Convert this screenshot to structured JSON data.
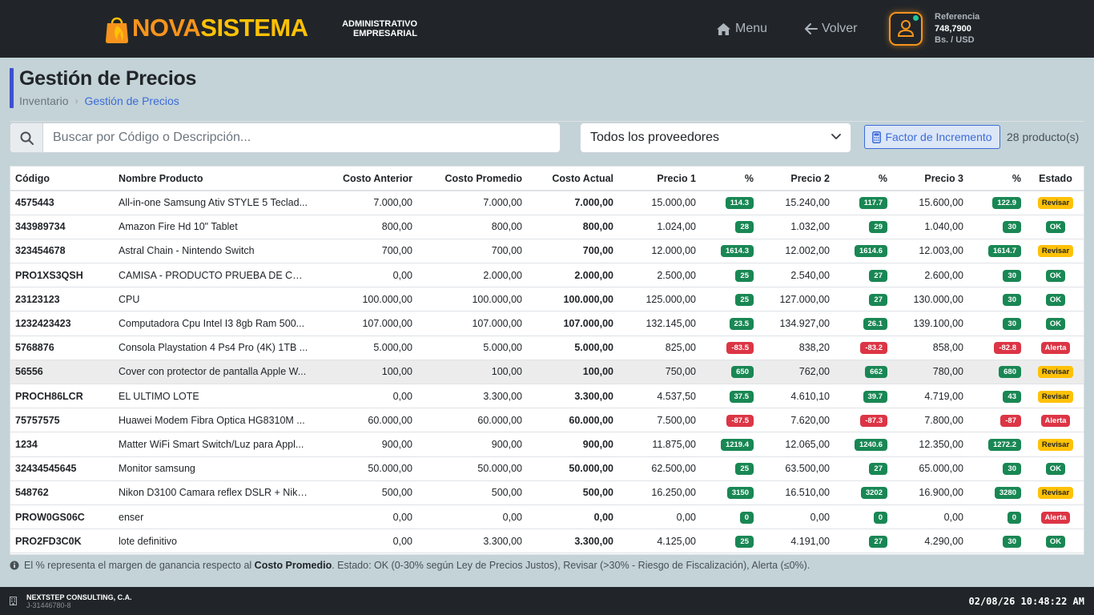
{
  "brand": {
    "name_part1": "NOVA",
    "name_part2": "SISTEMA",
    "subtitle_line1": "ADMINISTRATIVO",
    "subtitle_line2": "EMPRESARIAL",
    "colors": {
      "orange": "#f7941d",
      "yellow": "#ffc107"
    }
  },
  "nav": {
    "menu_label": "Menu",
    "back_label": "Volver"
  },
  "reference": {
    "label": "Referencia",
    "value": "748,7900",
    "unit": "Bs. / USD"
  },
  "page": {
    "title": "Gestión de Precios",
    "breadcrumb": [
      "Inventario",
      "Gestión de Precios"
    ]
  },
  "filters": {
    "search_placeholder": "Buscar por Código o Descripción...",
    "supplier_selected": "Todos los proveedores",
    "factor_button_label": "Factor de Incremento",
    "product_count": "28 producto(s)"
  },
  "table": {
    "headers": [
      "Código",
      "Nombre Producto",
      "Costo Anterior",
      "Costo Promedio",
      "Costo Actual",
      "Precio 1",
      "%",
      "Precio 2",
      "%",
      "Precio 3",
      "%",
      "Estado"
    ],
    "rows": [
      {
        "code": "4575443",
        "name": "All-in-one Samsung Ativ STYLE 5 Teclad...",
        "cost_prev": "7.000,00",
        "cost_avg": "7.000,00",
        "cost_cur": "7.000,00",
        "p1": "15.000,00",
        "pct1": "114.3",
        "p2": "15.240,00",
        "pct2": "117.7",
        "p3": "15.600,00",
        "pct3": "122.9",
        "status": "Revisar"
      },
      {
        "code": "343989734",
        "name": "Amazon Fire Hd 10\" Tablet",
        "cost_prev": "800,00",
        "cost_avg": "800,00",
        "cost_cur": "800,00",
        "p1": "1.024,00",
        "pct1": "28",
        "p2": "1.032,00",
        "pct2": "29",
        "p3": "1.040,00",
        "pct3": "30",
        "status": "OK"
      },
      {
        "code": "323454678",
        "name": "Astral Chain - Nintendo Switch",
        "cost_prev": "700,00",
        "cost_avg": "700,00",
        "cost_cur": "700,00",
        "p1": "12.000,00",
        "pct1": "1614.3",
        "p2": "12.002,00",
        "pct2": "1614.6",
        "p3": "12.003,00",
        "pct3": "1614.7",
        "status": "Revisar"
      },
      {
        "code": "PRO1XS3QSH",
        "name": "CAMISA - PRODUCTO PRUEBA DE COL...",
        "cost_prev": "0,00",
        "cost_avg": "2.000,00",
        "cost_cur": "2.000,00",
        "p1": "2.500,00",
        "pct1": "25",
        "p2": "2.540,00",
        "pct2": "27",
        "p3": "2.600,00",
        "pct3": "30",
        "status": "OK"
      },
      {
        "code": "23123123",
        "name": "CPU",
        "cost_prev": "100.000,00",
        "cost_avg": "100.000,00",
        "cost_cur": "100.000,00",
        "p1": "125.000,00",
        "pct1": "25",
        "p2": "127.000,00",
        "pct2": "27",
        "p3": "130.000,00",
        "pct3": "30",
        "status": "OK"
      },
      {
        "code": "1232423423",
        "name": "Computadora Cpu Intel I3 8gb Ram 500...",
        "cost_prev": "107.000,00",
        "cost_avg": "107.000,00",
        "cost_cur": "107.000,00",
        "p1": "132.145,00",
        "pct1": "23.5",
        "p2": "134.927,00",
        "pct2": "26.1",
        "p3": "139.100,00",
        "pct3": "30",
        "status": "OK"
      },
      {
        "code": "5768876",
        "name": "Consola Playstation 4 Ps4 Pro (4K) 1TB ...",
        "cost_prev": "5.000,00",
        "cost_avg": "5.000,00",
        "cost_cur": "5.000,00",
        "p1": "825,00",
        "pct1": "-83.5",
        "p2": "838,20",
        "pct2": "-83.2",
        "p3": "858,00",
        "pct3": "-82.8",
        "status": "Alerta"
      },
      {
        "code": "56556",
        "name": "Cover con protector de pantalla Apple W...",
        "cost_prev": "100,00",
        "cost_avg": "100,00",
        "cost_cur": "100,00",
        "p1": "750,00",
        "pct1": "650",
        "p2": "762,00",
        "pct2": "662",
        "p3": "780,00",
        "pct3": "680",
        "status": "Revisar",
        "highlight": true
      },
      {
        "code": "PROCH86LCR",
        "name": "EL ULTIMO LOTE",
        "cost_prev": "0,00",
        "cost_avg": "3.300,00",
        "cost_cur": "3.300,00",
        "p1": "4.537,50",
        "pct1": "37.5",
        "p2": "4.610,10",
        "pct2": "39.7",
        "p3": "4.719,00",
        "pct3": "43",
        "status": "Revisar"
      },
      {
        "code": "75757575",
        "name": "Huawei Modem Fibra Optica HG8310M ...",
        "cost_prev": "60.000,00",
        "cost_avg": "60.000,00",
        "cost_cur": "60.000,00",
        "p1": "7.500,00",
        "pct1": "-87.5",
        "p2": "7.620,00",
        "pct2": "-87.3",
        "p3": "7.800,00",
        "pct3": "-87",
        "status": "Alerta"
      },
      {
        "code": "1234",
        "name": "Matter WiFi Smart Switch/Luz para Appl...",
        "cost_prev": "900,00",
        "cost_avg": "900,00",
        "cost_cur": "900,00",
        "p1": "11.875,00",
        "pct1": "1219.4",
        "p2": "12.065,00",
        "pct2": "1240.6",
        "p3": "12.350,00",
        "pct3": "1272.2",
        "status": "Revisar"
      },
      {
        "code": "32434545645",
        "name": "Monitor samsung",
        "cost_prev": "50.000,00",
        "cost_avg": "50.000,00",
        "cost_cur": "50.000,00",
        "p1": "62.500,00",
        "pct1": "25",
        "p2": "63.500,00",
        "pct2": "27",
        "p3": "65.000,00",
        "pct3": "30",
        "status": "OK"
      },
      {
        "code": "548762",
        "name": "Nikon D3100 Camara reflex DSLR + Nikk...",
        "cost_prev": "500,00",
        "cost_avg": "500,00",
        "cost_cur": "500,00",
        "p1": "16.250,00",
        "pct1": "3150",
        "p2": "16.510,00",
        "pct2": "3202",
        "p3": "16.900,00",
        "pct3": "3280",
        "status": "Revisar"
      },
      {
        "code": "PROW0GS06C",
        "name": "enser",
        "cost_prev": "0,00",
        "cost_avg": "0,00",
        "cost_cur": "0,00",
        "p1": "0,00",
        "pct1": "0",
        "p2": "0,00",
        "pct2": "0",
        "p3": "0,00",
        "pct3": "0",
        "status": "Alerta"
      },
      {
        "code": "PRO2FD3C0K",
        "name": "lote definitivo",
        "cost_prev": "0,00",
        "cost_avg": "3.300,00",
        "cost_cur": "3.300,00",
        "p1": "4.125,00",
        "pct1": "25",
        "p2": "4.191,00",
        "pct2": "27",
        "p3": "4.290,00",
        "pct3": "30",
        "status": "OK"
      }
    ]
  },
  "footnote": {
    "prefix": "El % representa el margen de ganancia respecto al ",
    "bold": "Costo Promedio",
    "suffix": ". Estado: OK (0-30% según Ley de Precios Justos), Revisar (>30% - Riesgo de Fiscalización), Alerta (≤0%)."
  },
  "footer": {
    "company_name": "NEXTSTEP CONSULTING, C.A.",
    "company_id": "J-31446780-8",
    "datetime": "02/08/26 10:48:22 AM"
  },
  "icons": {
    "logo": "shopping-bag-icon",
    "menu": "home-icon",
    "back": "arrow-left-icon",
    "avatar": "user-icon",
    "search": "search-icon",
    "select": "chevron-down-icon",
    "factor": "calculator-icon",
    "info": "info-icon",
    "company": "building-icon"
  }
}
